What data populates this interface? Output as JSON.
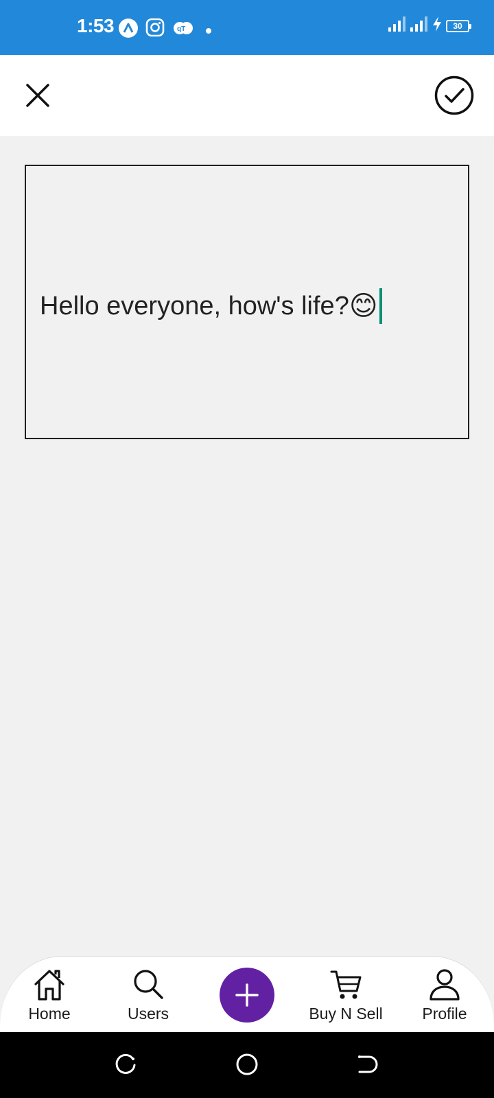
{
  "status_bar": {
    "time": "1:53",
    "battery_level": "30",
    "icons": [
      "app-a-icon",
      "instagram-icon",
      "chat-icon",
      "notification-dot-icon",
      "signal-icon",
      "signal-icon",
      "charging-icon",
      "battery-icon"
    ]
  },
  "toolbar": {
    "close_icon": "close-icon",
    "confirm_icon": "check-circle-icon"
  },
  "editor": {
    "text": "Hello everyone, how's life?",
    "emoji": "😊",
    "border_color": "#1f1f1f",
    "caret_color": "#0a8f74"
  },
  "bottom_nav": {
    "items": [
      {
        "label": "Home",
        "icon": "home-icon"
      },
      {
        "label": "Users",
        "icon": "search-icon"
      },
      {
        "label": "",
        "icon": "plus-icon"
      },
      {
        "label": "Buy N Sell",
        "icon": "cart-icon"
      },
      {
        "label": "Profile",
        "icon": "person-icon"
      }
    ],
    "fab_color": "#6221a3"
  },
  "colors": {
    "status_bar": "#2288d9",
    "background": "#f1f1f1"
  }
}
